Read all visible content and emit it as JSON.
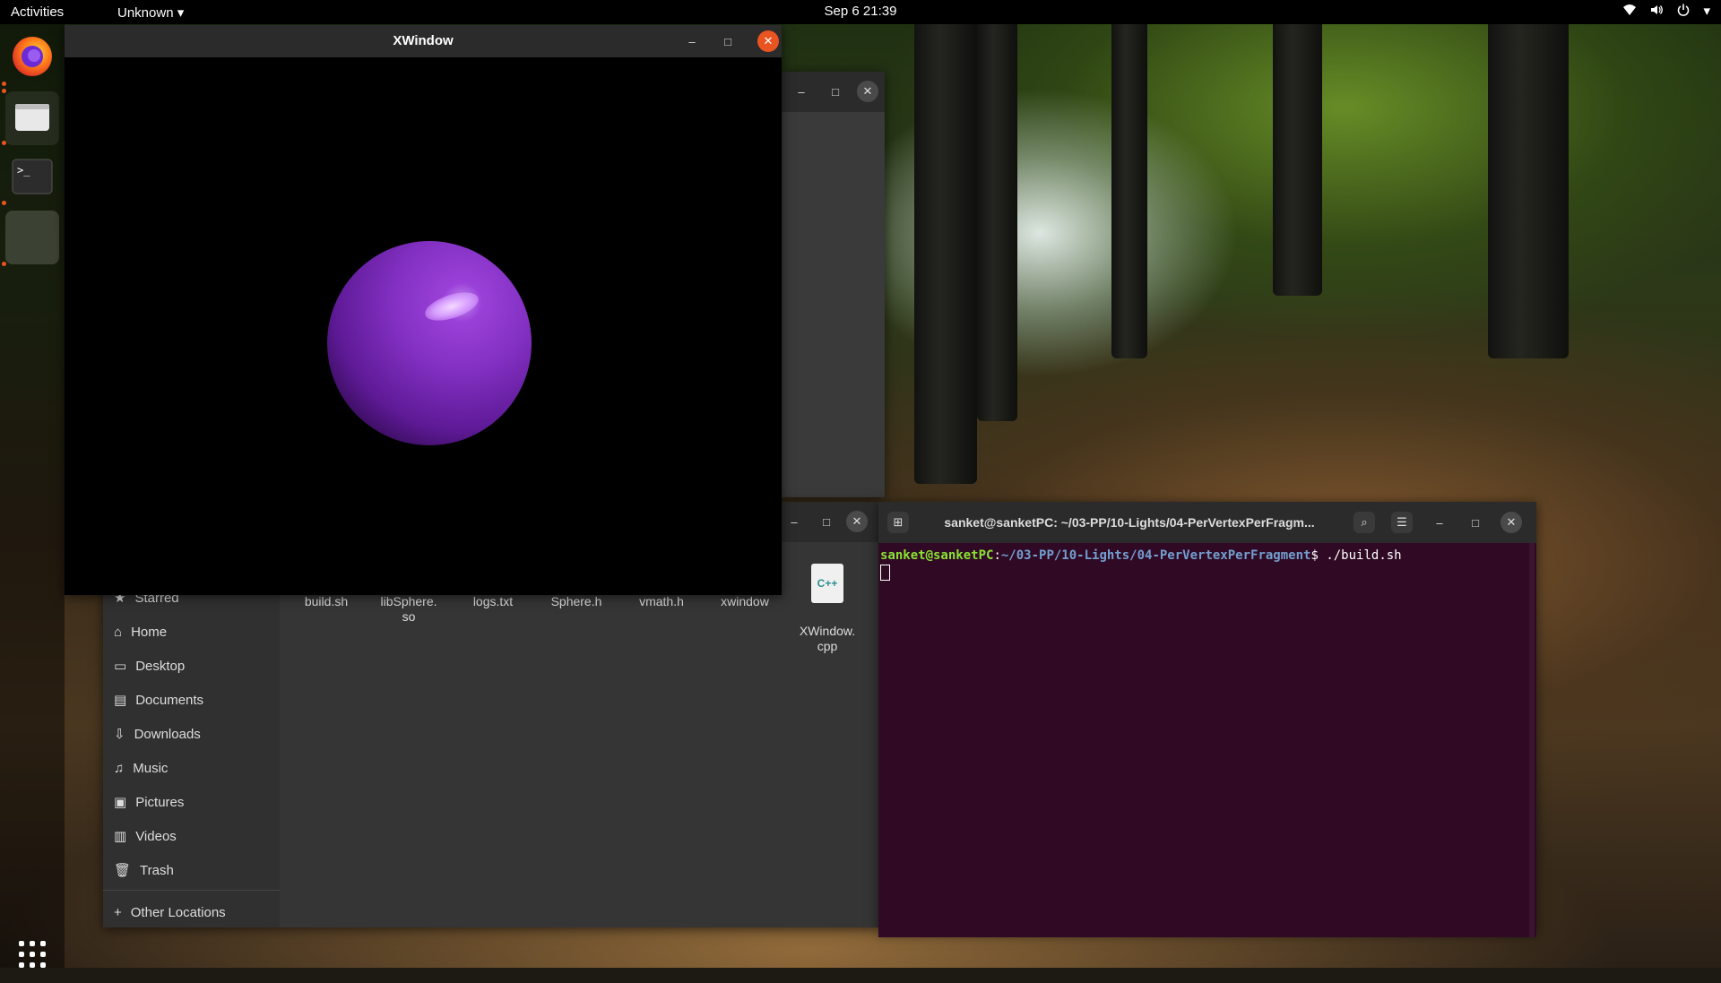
{
  "topbar": {
    "activities": "Activities",
    "app_menu": "Unknown",
    "clock": "Sep 6  21:39",
    "tray_icons": [
      "wifi-icon",
      "volume-icon",
      "power-icon",
      "chevron-down-icon"
    ]
  },
  "dock": {
    "items": [
      "firefox",
      "files",
      "terminal",
      "xwindow"
    ],
    "show_apps_icon": "grid-icon"
  },
  "xwindow": {
    "title": "XWindow",
    "sphere_color": "#8a33c8",
    "background": "#000000"
  },
  "files": {
    "sidebar": [
      {
        "label": "Starred",
        "icon": "star-icon"
      },
      {
        "label": "Home",
        "icon": "home-icon"
      },
      {
        "label": "Desktop",
        "icon": "desktop-icon"
      },
      {
        "label": "Documents",
        "icon": "document-icon"
      },
      {
        "label": "Downloads",
        "icon": "download-icon"
      },
      {
        "label": "Music",
        "icon": "music-icon"
      },
      {
        "label": "Pictures",
        "icon": "pictures-icon"
      },
      {
        "label": "Videos",
        "icon": "videos-icon"
      },
      {
        "label": "Trash",
        "icon": "trash-icon"
      }
    ],
    "other_locations": "Other Locations",
    "items": [
      {
        "name": "build.sh"
      },
      {
        "name": "libSphere.\nso"
      },
      {
        "name": "logs.txt"
      },
      {
        "name": "Sphere.h"
      },
      {
        "name": "vmath.h"
      },
      {
        "name": "xwindow"
      },
      {
        "name": "XWindow.\ncpp",
        "badge": "C++"
      }
    ]
  },
  "terminal": {
    "title": "sanket@sanketPC: ~/03-PP/10-Lights/04-PerVertexPerFragm...",
    "prompt_user": "sanket@sanketPC",
    "prompt_sep": ":",
    "prompt_path": "~/03-PP/10-Lights/04-PerVertexPerFragment",
    "prompt_dollar": "$",
    "command": " ./build.sh"
  },
  "colors": {
    "accent": "#e95420",
    "terminal_bg": "#300a24",
    "prompt_user": "#8ae234",
    "prompt_path": "#729fcf"
  }
}
